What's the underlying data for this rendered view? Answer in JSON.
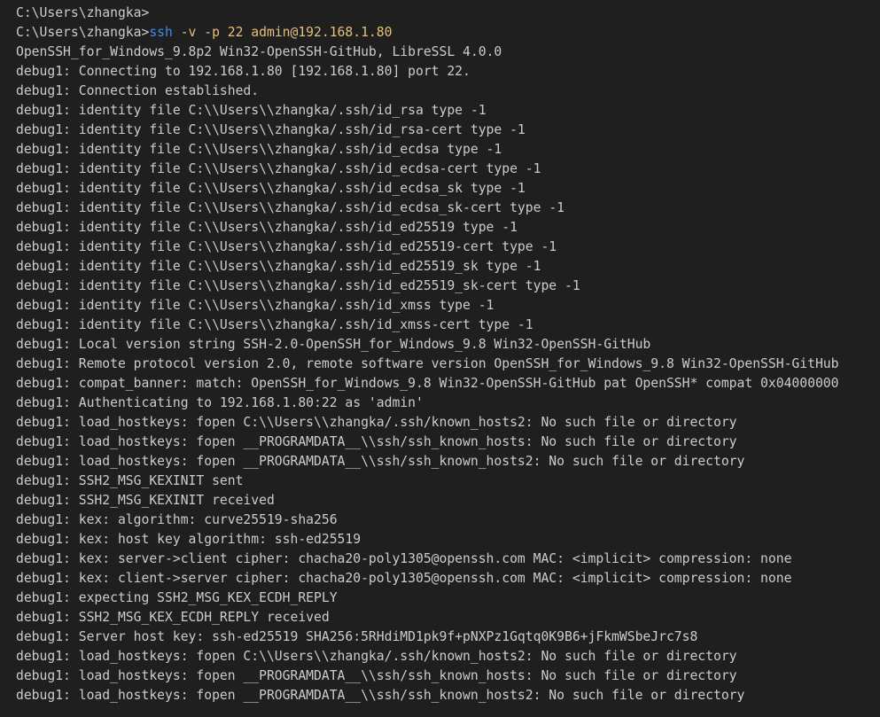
{
  "terminal": {
    "prompt_previous": "C:\\Users\\zhangka>",
    "prompt": "C:\\Users\\zhangka>",
    "command": "ssh",
    "command_args": " -v -p 22 admin@192.168.1.80",
    "colors": {
      "background": "#1f1f1f",
      "text": "#cccccc",
      "command": "#3b8eea",
      "args": "#e5c07b"
    },
    "output": [
      "OpenSSH_for_Windows_9.8p2 Win32-OpenSSH-GitHub, LibreSSL 4.0.0",
      "debug1: Connecting to 192.168.1.80 [192.168.1.80] port 22.",
      "debug1: Connection established.",
      "debug1: identity file C:\\\\Users\\\\zhangka/.ssh/id_rsa type -1",
      "debug1: identity file C:\\\\Users\\\\zhangka/.ssh/id_rsa-cert type -1",
      "debug1: identity file C:\\\\Users\\\\zhangka/.ssh/id_ecdsa type -1",
      "debug1: identity file C:\\\\Users\\\\zhangka/.ssh/id_ecdsa-cert type -1",
      "debug1: identity file C:\\\\Users\\\\zhangka/.ssh/id_ecdsa_sk type -1",
      "debug1: identity file C:\\\\Users\\\\zhangka/.ssh/id_ecdsa_sk-cert type -1",
      "debug1: identity file C:\\\\Users\\\\zhangka/.ssh/id_ed25519 type -1",
      "debug1: identity file C:\\\\Users\\\\zhangka/.ssh/id_ed25519-cert type -1",
      "debug1: identity file C:\\\\Users\\\\zhangka/.ssh/id_ed25519_sk type -1",
      "debug1: identity file C:\\\\Users\\\\zhangka/.ssh/id_ed25519_sk-cert type -1",
      "debug1: identity file C:\\\\Users\\\\zhangka/.ssh/id_xmss type -1",
      "debug1: identity file C:\\\\Users\\\\zhangka/.ssh/id_xmss-cert type -1",
      "debug1: Local version string SSH-2.0-OpenSSH_for_Windows_9.8 Win32-OpenSSH-GitHub",
      "debug1: Remote protocol version 2.0, remote software version OpenSSH_for_Windows_9.8 Win32-OpenSSH-GitHub",
      "debug1: compat_banner: match: OpenSSH_for_Windows_9.8 Win32-OpenSSH-GitHub pat OpenSSH* compat 0x04000000",
      "debug1: Authenticating to 192.168.1.80:22 as 'admin'",
      "debug1: load_hostkeys: fopen C:\\\\Users\\\\zhangka/.ssh/known_hosts2: No such file or directory",
      "debug1: load_hostkeys: fopen __PROGRAMDATA__\\\\ssh/ssh_known_hosts: No such file or directory",
      "debug1: load_hostkeys: fopen __PROGRAMDATA__\\\\ssh/ssh_known_hosts2: No such file or directory",
      "debug1: SSH2_MSG_KEXINIT sent",
      "debug1: SSH2_MSG_KEXINIT received",
      "debug1: kex: algorithm: curve25519-sha256",
      "debug1: kex: host key algorithm: ssh-ed25519",
      "debug1: kex: server->client cipher: chacha20-poly1305@openssh.com MAC: <implicit> compression: none",
      "debug1: kex: client->server cipher: chacha20-poly1305@openssh.com MAC: <implicit> compression: none",
      "debug1: expecting SSH2_MSG_KEX_ECDH_REPLY",
      "debug1: SSH2_MSG_KEX_ECDH_REPLY received",
      "debug1: Server host key: ssh-ed25519 SHA256:5RHdiMD1pk9f+pNXPz1Gqtq0K9B6+jFkmWSbeJrc7s8",
      "debug1: load_hostkeys: fopen C:\\\\Users\\\\zhangka/.ssh/known_hosts2: No such file or directory",
      "debug1: load_hostkeys: fopen __PROGRAMDATA__\\\\ssh/ssh_known_hosts: No such file or directory",
      "debug1: load_hostkeys: fopen __PROGRAMDATA__\\\\ssh/ssh_known_hosts2: No such file or directory"
    ]
  }
}
